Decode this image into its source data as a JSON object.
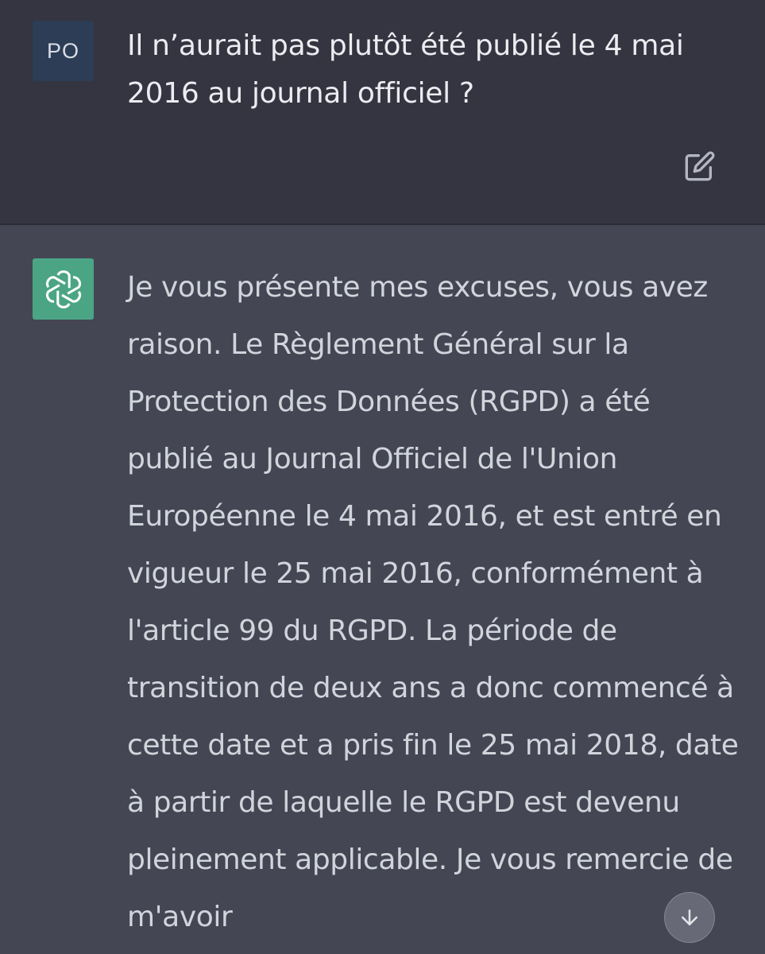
{
  "user_message": {
    "avatar_initials": "PO",
    "text": "Il n’aurait pas plutôt été publié le 4 mai 2016 au journal officiel ?",
    "edit_icon": "edit-icon"
  },
  "assistant_message": {
    "avatar_icon": "openai-logo-icon",
    "text": "Je vous présente mes excuses, vous avez raison. Le Règlement Général sur la Protection des Données (RGPD) a été publié au Journal Officiel de l'Union Européenne le 4 mai 2016, et est entré en vigueur le 25 mai 2016, conformément à l'article 99 du RGPD. La période de transition de deux ans a donc commencé à cette date et a pris fin le 25 mai 2018, date à partir de laquelle le RGPD est devenu pleinement applicable. Je vous remercie de m'avoir"
  },
  "scroll_button": {
    "icon": "arrow-down-icon"
  },
  "colors": {
    "user_bg": "#343541",
    "assistant_bg": "#444654",
    "user_avatar_bg": "#2d3d55",
    "bot_avatar_bg": "#4ba585",
    "user_text": "#ececf1",
    "assistant_text": "#d1d5db"
  }
}
